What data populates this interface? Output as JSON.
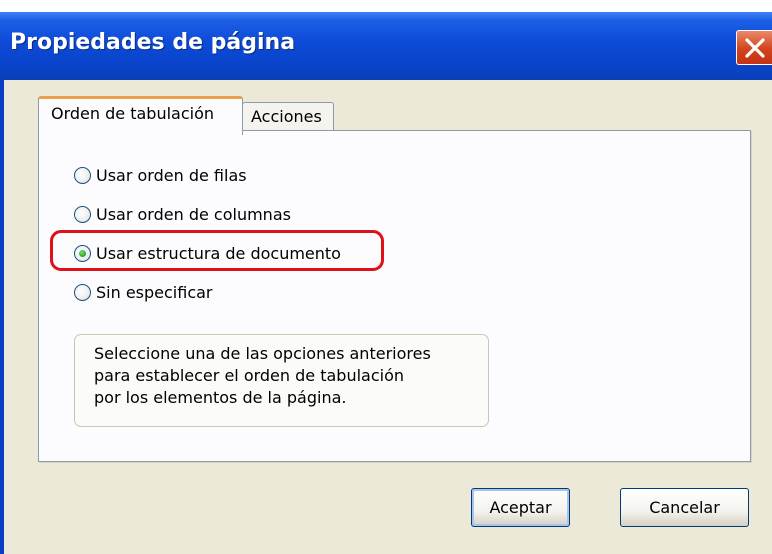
{
  "dialog": {
    "title": "Propiedades de página"
  },
  "tabs": [
    {
      "label": "Orden de tabulación",
      "active": true
    },
    {
      "label": "Acciones",
      "active": false
    }
  ],
  "options": [
    {
      "label": "Usar orden de filas",
      "checked": false
    },
    {
      "label": "Usar orden de columnas",
      "checked": false
    },
    {
      "label": "Usar estructura de documento",
      "checked": true
    },
    {
      "label": "Sin especificar",
      "checked": false
    }
  ],
  "info": {
    "lines": [
      "Seleccione una de las opciones anteriores",
      "para establecer el orden de tabulación",
      "por los elementos de la página."
    ]
  },
  "buttons": {
    "ok_label": "Aceptar",
    "cancel_label": "Cancelar"
  },
  "colors": {
    "titlebar": "#0a44cc",
    "highlight": "#e01019",
    "close_button": "#d2441c"
  },
  "icons": {
    "close": "close-icon"
  }
}
